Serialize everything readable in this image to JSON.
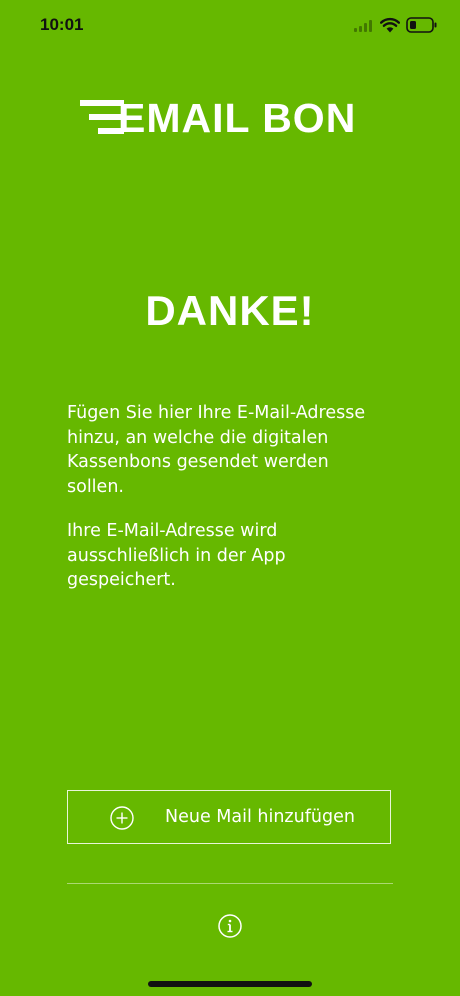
{
  "status_bar": {
    "time": "10:01"
  },
  "logo": {
    "text": "EMAIL BON"
  },
  "main": {
    "title": "DANKE!",
    "description_1": "Fügen Sie hier Ihre E-Mail-Adresse hinzu, an welche die digitalen Kassenbons gesendet werden sollen.",
    "description_2": "Ihre E-Mail-Adresse wird ausschließlich in der App gespeichert."
  },
  "actions": {
    "add_mail_label": "Neue Mail hinzufügen"
  },
  "icons": {
    "add": "plus-circle-icon",
    "info": "info-icon",
    "wifi": "wifi-icon",
    "battery": "battery-icon",
    "signal": "signal-icon"
  },
  "colors": {
    "background": "#66B800",
    "foreground": "#FFFFFF",
    "status_text": "#111111"
  }
}
